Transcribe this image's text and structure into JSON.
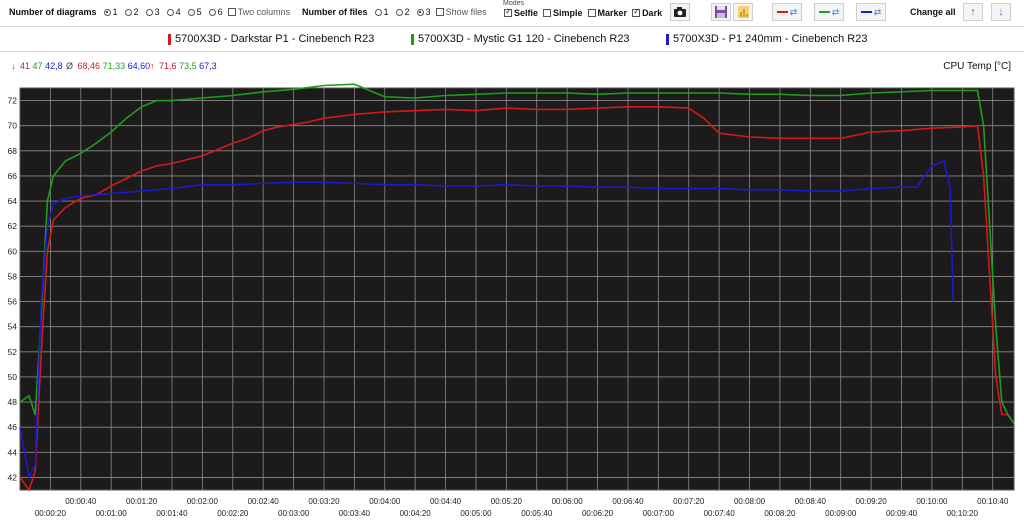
{
  "toolbar": {
    "diagrams_label": "Number of diagrams",
    "diagram_options": [
      "1",
      "2",
      "3",
      "4",
      "5",
      "6"
    ],
    "diagram_selected": "1",
    "two_columns_label": "Two columns",
    "files_label": "Number of files",
    "file_options": [
      "1",
      "2",
      "3"
    ],
    "file_selected": "3",
    "show_files_label": "Show files",
    "modes_title": "Modes",
    "modes": [
      {
        "label": "Selfie",
        "checked": true
      },
      {
        "label": "Simple",
        "checked": false
      },
      {
        "label": "Marker",
        "checked": false
      },
      {
        "label": "Dark",
        "checked": true
      }
    ],
    "change_all_label": "Change all",
    "accent": "#3b78d8"
  },
  "legend": [
    {
      "label": "5700X3D - Darkstar P1 - Cinebench R23",
      "color": "#d11a1a"
    },
    {
      "label": "5700X3D - Mystic G1 120 - Cinebench R23",
      "color": "#1e9e1e"
    },
    {
      "label": "5700X3D - P1 240mm - Cinebench R23",
      "color": "#1a1ad1"
    }
  ],
  "stats": {
    "min": {
      "symbol": "↓",
      "values": [
        "41",
        "47",
        "42,8"
      ]
    },
    "avg": {
      "symbol": "Ø",
      "values": [
        "68,46",
        "71,33",
        "64,60"
      ]
    },
    "max": {
      "symbol": "↑",
      "values": [
        "71,6",
        "73,5",
        "67,3"
      ]
    }
  },
  "unit_label": "CPU Temp [°C]",
  "chart_data": {
    "type": "line",
    "ylabel": "CPU Temp [°C]",
    "ylim": [
      41,
      73
    ],
    "yticks": [
      42,
      44,
      46,
      48,
      50,
      52,
      54,
      56,
      58,
      60,
      62,
      64,
      66,
      68,
      70,
      72
    ],
    "xlim": [
      0,
      654
    ],
    "xticks_top": [
      "00:00:40",
      "00:01:20",
      "00:02:00",
      "00:02:40",
      "00:03:20",
      "00:04:00",
      "00:04:40",
      "00:05:20",
      "00:06:00",
      "00:06:40",
      "00:07:20",
      "00:08:00",
      "00:08:40",
      "00:09:20",
      "00:10:00",
      "00:10:40"
    ],
    "xticks_bottom": [
      "00:00:20",
      "00:01:00",
      "00:01:40",
      "00:02:20",
      "00:03:00",
      "00:03:40",
      "00:04:20",
      "00:05:00",
      "00:05:40",
      "00:06:20",
      "00:07:00",
      "00:07:40",
      "00:08:20",
      "00:09:00",
      "00:09:40",
      "00:10:20"
    ],
    "background": "#1c1a1a",
    "grid": true,
    "series": [
      {
        "name": "5700X3D - Darkstar P1 - Cinebench R23",
        "color": "#d11a1a",
        "x": [
          0,
          6,
          10,
          14,
          18,
          22,
          30,
          40,
          50,
          60,
          70,
          80,
          90,
          100,
          110,
          120,
          130,
          140,
          150,
          160,
          170,
          180,
          190,
          200,
          220,
          240,
          260,
          280,
          300,
          320,
          340,
          360,
          380,
          400,
          420,
          440,
          450,
          460,
          480,
          500,
          520,
          540,
          560,
          580,
          600,
          620,
          630,
          634,
          638,
          642,
          646,
          650,
          654
        ],
        "y": [
          42,
          41,
          42.5,
          52,
          60,
          62.5,
          63.5,
          64.2,
          64.5,
          65.2,
          65.8,
          66.4,
          66.8,
          67.0,
          67.3,
          67.6,
          68.1,
          68.6,
          69.0,
          69.6,
          69.9,
          70.1,
          70.3,
          70.6,
          70.9,
          71.1,
          71.2,
          71.3,
          71.2,
          71.4,
          71.3,
          71.3,
          71.4,
          71.5,
          71.5,
          71.4,
          70.6,
          69.4,
          69.1,
          69.0,
          69.0,
          69.0,
          69.5,
          69.6,
          69.8,
          69.9,
          70.0,
          66,
          58,
          50,
          47,
          47,
          46.3
        ]
      },
      {
        "name": "5700X3D - Mystic G1 120 - Cinebench R23",
        "color": "#1e9e1e",
        "x": [
          0,
          6,
          10,
          14,
          18,
          22,
          30,
          40,
          50,
          60,
          70,
          80,
          90,
          100,
          120,
          140,
          160,
          180,
          200,
          220,
          240,
          260,
          280,
          300,
          320,
          340,
          360,
          380,
          400,
          420,
          440,
          460,
          480,
          500,
          520,
          540,
          560,
          580,
          600,
          620,
          630,
          634,
          638,
          642,
          646,
          650,
          654
        ],
        "y": [
          48,
          48.5,
          47,
          55,
          64,
          66,
          67.2,
          67.8,
          68.6,
          69.5,
          70.6,
          71.5,
          72.0,
          72.0,
          72.2,
          72.4,
          72.7,
          72.9,
          73.2,
          73.3,
          72.3,
          72.2,
          72.4,
          72.5,
          72.6,
          72.6,
          72.6,
          72.5,
          72.6,
          72.6,
          72.6,
          72.6,
          72.5,
          72.5,
          72.4,
          72.4,
          72.6,
          72.7,
          72.8,
          72.8,
          72.8,
          70,
          62,
          54,
          48,
          47,
          46.3
        ]
      },
      {
        "name": "5700X3D - P1 240mm - Cinebench R23",
        "color": "#1a1ad1",
        "x": [
          0,
          6,
          10,
          14,
          18,
          22,
          30,
          40,
          60,
          80,
          100,
          120,
          140,
          160,
          180,
          200,
          220,
          240,
          260,
          280,
          300,
          320,
          340,
          360,
          380,
          400,
          420,
          440,
          460,
          480,
          500,
          520,
          540,
          560,
          580,
          590,
          600,
          606,
          608,
          612,
          614
        ],
        "y": [
          46,
          42,
          43,
          56,
          62,
          63.8,
          64.2,
          64.4,
          64.6,
          64.8,
          65.0,
          65.3,
          65.3,
          65.4,
          65.5,
          65.5,
          65.4,
          65.3,
          65.3,
          65.2,
          65.2,
          65.3,
          65.2,
          65.2,
          65.1,
          65.1,
          65.0,
          65.0,
          65.0,
          64.9,
          64.9,
          64.8,
          64.8,
          65.0,
          65.1,
          65.1,
          66.8,
          67.1,
          67.2,
          65,
          56
        ]
      }
    ]
  }
}
